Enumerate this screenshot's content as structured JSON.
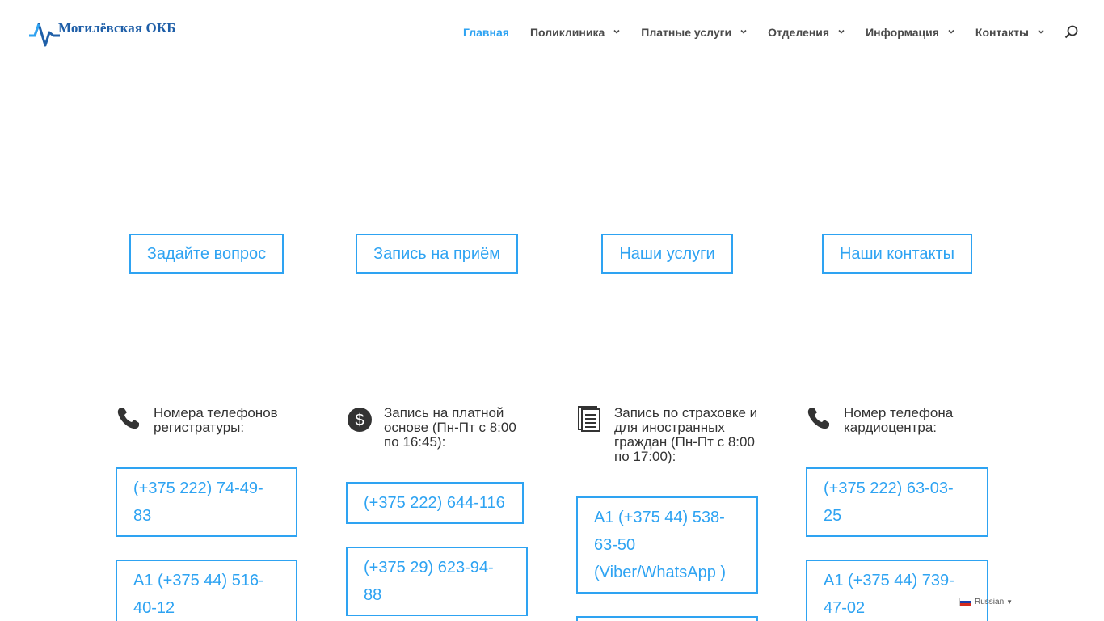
{
  "header": {
    "logo_text": "Могилёвская ОКБ",
    "nav": [
      {
        "label": "Главная",
        "active": true,
        "has_dropdown": false
      },
      {
        "label": "Поликлиника",
        "active": false,
        "has_dropdown": true
      },
      {
        "label": "Платные услуги",
        "active": false,
        "has_dropdown": true
      },
      {
        "label": "Отделения",
        "active": false,
        "has_dropdown": true
      },
      {
        "label": "Информация",
        "active": false,
        "has_dropdown": true
      },
      {
        "label": "Контакты",
        "active": false,
        "has_dropdown": true
      }
    ],
    "search_icon": "search-icon"
  },
  "actions": {
    "ask_question": "Задайте вопрос",
    "appointment": "Запись на приём",
    "services": "Наши услуги",
    "contacts": "Наши контакты"
  },
  "blurbs": [
    {
      "icon": "phone-icon",
      "title": "Номера телефонов регистратуры:",
      "phones": [
        "(+375 222) 74-49-83",
        "A1 (+375 44) 516-40-12"
      ]
    },
    {
      "icon": "dollar-icon",
      "title": "Запись на платной основе (Пн-Пт с 8:00 по 16:45):",
      "phones": [
        "(+375 222) 644-116",
        "(+375 29) 623-94-88"
      ]
    },
    {
      "icon": "document-icon",
      "title": "Запись по страховке и для иностранных граждан (Пн-Пт с 8:00 по 17:00):",
      "phones": [
        "A1 (+375 44) 538-63-50 (Viber/WhatsApp )"
      ]
    },
    {
      "icon": "phone-icon",
      "title": "Номер телефона кардиоцентра:",
      "phones": [
        "(+375 222) 63-03-25",
        "A1 (+375 44) 739-47-02"
      ]
    }
  ],
  "language": {
    "label": "Russian",
    "arrow": "▼"
  },
  "colors": {
    "accent": "#2ea3f2",
    "logo": "#1f5fa8",
    "text": "#333333"
  }
}
